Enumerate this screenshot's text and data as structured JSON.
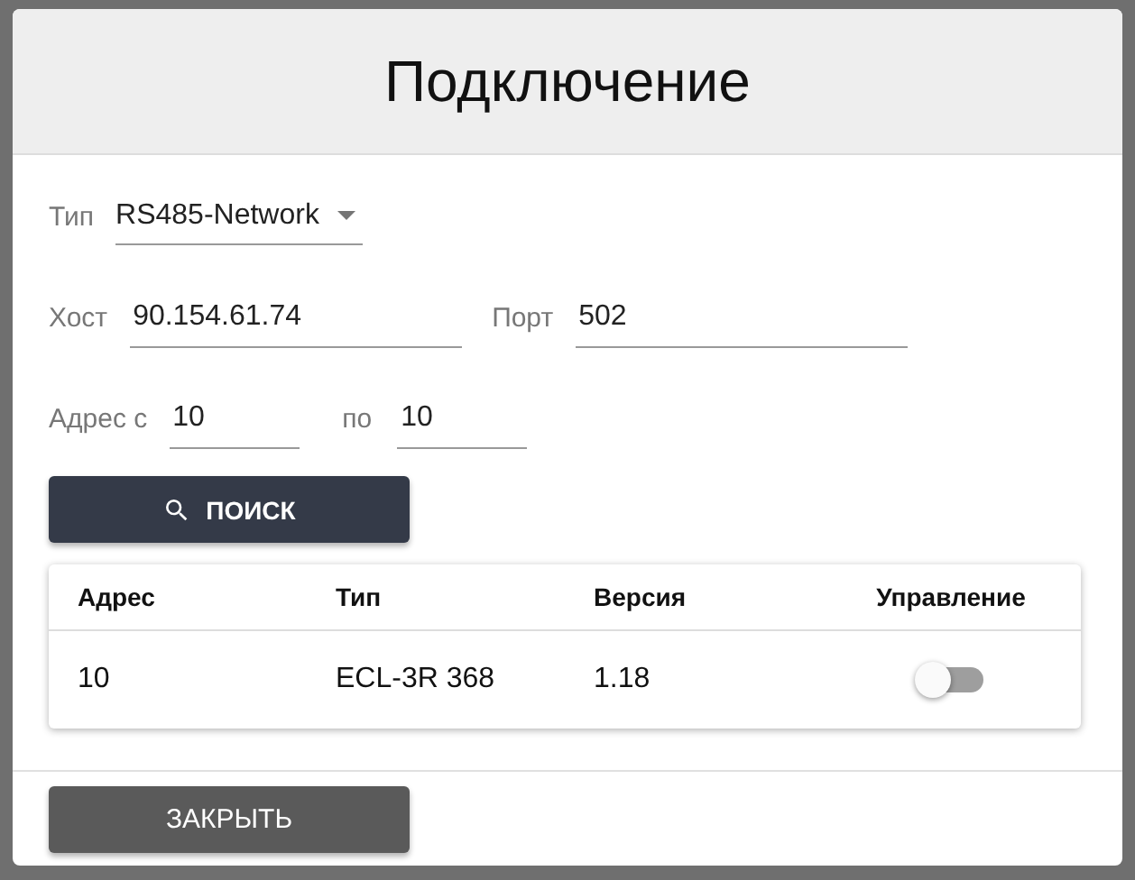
{
  "dialog": {
    "title": "Подключение",
    "type_field": {
      "label": "Тип",
      "value": "RS485-Network"
    },
    "host_field": {
      "label": "Хост",
      "value": "90.154.61.74"
    },
    "port_field": {
      "label": "Порт",
      "value": "502"
    },
    "address_from": {
      "label": "Адрес с",
      "value": "10"
    },
    "address_to": {
      "label": "по",
      "value": "10"
    },
    "search_button": "ПОИСК",
    "table": {
      "columns": [
        "Адрес",
        "Тип",
        "Версия",
        "Управление"
      ],
      "rows": [
        {
          "address": "10",
          "type": "ECL-3R 368",
          "version": "1.18",
          "control_on": false
        }
      ]
    },
    "close_button": "ЗАКРЫТЬ"
  }
}
